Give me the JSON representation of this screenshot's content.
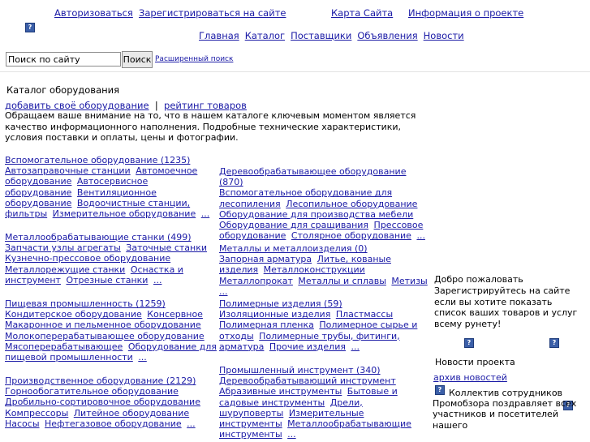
{
  "header": {
    "login": "Авторизоваться",
    "register": "Зарегистрироваться на сайте",
    "sitemap": "Карта Сайта",
    "about": "Информация о проекте"
  },
  "nav": [
    "Главная",
    "Каталог",
    "Поставщики",
    "Объявления",
    "Новости"
  ],
  "search": {
    "placeholder": "Поиск по сайту",
    "value": "Поиск по сайту",
    "button": "Поиск",
    "advanced": "Расширенный поиск"
  },
  "catalog": {
    "title": "Каталог оборудования",
    "add_link": "добавить своё оборудование",
    "separator": "|",
    "rating_link": "рейтинг товаров",
    "intro": "Обращаем ваше внимание на то, что в нашем каталоге ключевым моментом является качество информационного наполнения. Подробные технические характеристики, условия поставки и оплаты, цены и фотографии."
  },
  "categories_left": [
    {
      "title": "Вспомогательное оборудование (1235)",
      "items": [
        "Автозаправочные станции",
        "Автомоечное оборудование",
        "Автосервисное оборудование",
        "Вентиляционное оборудование",
        "Водоочистные станции, фильтры",
        "Измерительное оборудование",
        "..."
      ]
    },
    {
      "title": "Металлообрабатывающие станки (499)",
      "items": [
        "Запчасти узлы агрегаты",
        "Заточные станки",
        "Кузнечно-прессовое оборудование",
        "Металлорежущие станки",
        "Оснастка и инструмент",
        "Отрезные станки",
        "..."
      ]
    },
    {
      "title": "Пищевая промышленность (1259)",
      "items": [
        "Кондитерское оборудование",
        "Консервное",
        "Макаронное и пельменное оборудование",
        "Молокоперерабатывающее оборудование",
        "Мясоперерабатывающее",
        "Оборудование для пищевой промышленности",
        "..."
      ]
    },
    {
      "title": "Производственное оборудование (2129)",
      "items": [
        "Горнообогатительное оборудование",
        "Дробильно-сортировочное оборудование",
        "Компрессоры",
        "Литейное оборудование",
        "Насосы",
        "Нефтегазовое оборудование",
        "..."
      ]
    }
  ],
  "categories_right": [
    {
      "title": "Деревообрабатывающее оборудование (870)",
      "items": [
        "Вспомогательное оборудование для лесопиления",
        "Лесопильное оборудование",
        "Оборудование для производства мебели",
        "Оборудование для сращивания",
        "Прессовое оборудование",
        "Столярное оборудование",
        "..."
      ]
    },
    {
      "title": "Металлы и металлоизделия (0)",
      "items": [
        "Запорная арматура",
        "Литье, кованые изделия",
        "Металлоконструкции",
        "Металлопрокат",
        "Металлы и сплавы",
        "Метизы",
        "..."
      ]
    },
    {
      "title": "Полимерные изделия (59)",
      "items": [
        "Изоляционные изделия",
        "Пластмассы",
        "Полимерная пленка",
        "Полимерное сырье и отходы",
        "Полимерные трубы, фитинги, арматура",
        "Прочие изделия",
        "..."
      ]
    },
    {
      "title": "Промышленный инструмент (340)",
      "items": [
        "Деревообрабатывающий инструмент",
        "Абразивные инструменты",
        "Бытовые и садовые инструменты",
        "Дрели, шуруповерты",
        "Измерительные инструменты",
        "Металлообрабатывающие инструменты",
        "..."
      ]
    }
  ],
  "sidebar": {
    "welcome": "Добро пожаловать",
    "register_prompt": "Зарегистрируйтесь на сайте если вы хотите показать список ваших товаров и услуг всему рунету!",
    "news_title": "Новости проекта",
    "news_archive": "архив новостей",
    "news_text": "Коллектив сотрудников Промобзора поздравляет всех участников и посетителей нашего"
  },
  "help_icon": "?"
}
